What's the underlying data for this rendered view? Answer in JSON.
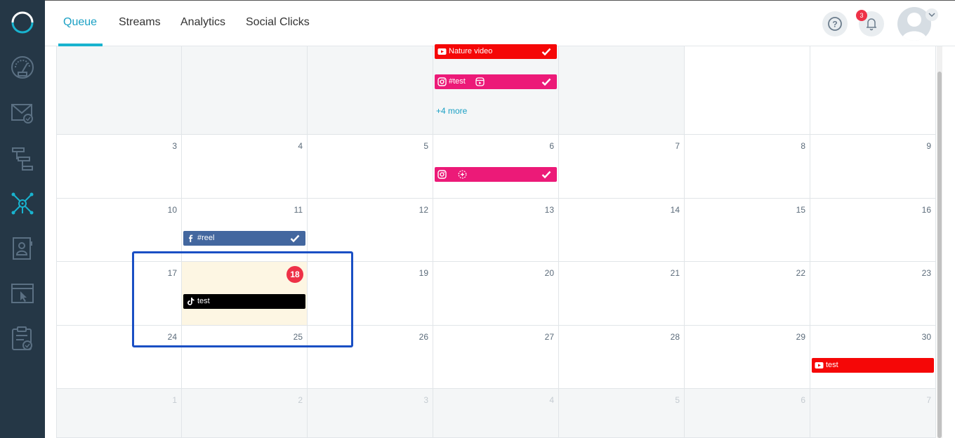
{
  "nav": {
    "tabs": [
      {
        "label": "Queue",
        "active": true
      },
      {
        "label": "Streams"
      },
      {
        "label": "Analytics"
      },
      {
        "label": "Social Clicks"
      }
    ],
    "notification_count": "3"
  },
  "sidebar_icons": [
    "logo",
    "speedometer-icon",
    "mail-icon",
    "workflow-icon",
    "social-network-icon",
    "contacts-icon",
    "landing-page-icon",
    "tasks-icon"
  ],
  "calendar": {
    "weeks": [
      {
        "days": [
          {
            "day": "",
            "state": "past",
            "posts": []
          },
          {
            "day": "",
            "state": "past",
            "posts": []
          },
          {
            "day": "",
            "state": "past",
            "posts": []
          },
          {
            "day": "",
            "state": "past",
            "posts": [
              {
                "network": "youtube",
                "label": "Nature video",
                "checked": true
              },
              {
                "network": "instagram",
                "label": "#test",
                "reel": true,
                "checked": true
              }
            ],
            "more": "+4 more"
          },
          {
            "day": "",
            "state": "past",
            "posts": []
          },
          {
            "day": "",
            "state": "normal",
            "posts": []
          },
          {
            "day": "",
            "state": "normal",
            "posts": []
          }
        ]
      },
      {
        "days": [
          {
            "day": "3",
            "state": "normal",
            "posts": []
          },
          {
            "day": "4",
            "state": "normal",
            "posts": []
          },
          {
            "day": "5",
            "state": "normal",
            "posts": []
          },
          {
            "day": "6",
            "state": "normal",
            "posts": [
              {
                "network": "instagram",
                "label": "",
                "story": true,
                "checked": true
              }
            ]
          },
          {
            "day": "7",
            "state": "normal",
            "posts": []
          },
          {
            "day": "8",
            "state": "normal",
            "posts": []
          },
          {
            "day": "9",
            "state": "normal",
            "posts": []
          }
        ]
      },
      {
        "days": [
          {
            "day": "10",
            "state": "normal",
            "posts": []
          },
          {
            "day": "11",
            "state": "normal",
            "posts": [
              {
                "network": "facebook",
                "label": "#reel",
                "checked": true
              }
            ]
          },
          {
            "day": "12",
            "state": "normal",
            "posts": []
          },
          {
            "day": "13",
            "state": "normal",
            "posts": []
          },
          {
            "day": "14",
            "state": "normal",
            "posts": []
          },
          {
            "day": "15",
            "state": "normal",
            "posts": []
          },
          {
            "day": "16",
            "state": "normal",
            "posts": []
          }
        ]
      },
      {
        "days": [
          {
            "day": "17",
            "state": "normal",
            "posts": []
          },
          {
            "day": "18",
            "state": "today",
            "posts": [
              {
                "network": "tiktok",
                "label": "test",
                "checked": false
              }
            ]
          },
          {
            "day": "19",
            "state": "normal",
            "posts": []
          },
          {
            "day": "20",
            "state": "normal",
            "posts": []
          },
          {
            "day": "21",
            "state": "normal",
            "posts": []
          },
          {
            "day": "22",
            "state": "normal",
            "posts": []
          },
          {
            "day": "23",
            "state": "normal",
            "posts": []
          }
        ]
      },
      {
        "days": [
          {
            "day": "24",
            "state": "normal",
            "posts": []
          },
          {
            "day": "25",
            "state": "normal",
            "posts": []
          },
          {
            "day": "26",
            "state": "normal",
            "posts": []
          },
          {
            "day": "27",
            "state": "normal",
            "posts": []
          },
          {
            "day": "28",
            "state": "normal",
            "posts": []
          },
          {
            "day": "29",
            "state": "normal",
            "posts": []
          },
          {
            "day": "30",
            "state": "normal",
            "posts": [
              {
                "network": "youtube",
                "label": "test",
                "checked": false
              }
            ]
          }
        ]
      },
      {
        "days": [
          {
            "day": "1",
            "state": "outside",
            "posts": []
          },
          {
            "day": "2",
            "state": "outside",
            "posts": []
          },
          {
            "day": "3",
            "state": "outside",
            "posts": []
          },
          {
            "day": "4",
            "state": "outside",
            "posts": []
          },
          {
            "day": "5",
            "state": "outside",
            "posts": []
          },
          {
            "day": "6",
            "state": "outside",
            "posts": []
          },
          {
            "day": "7",
            "state": "outside",
            "posts": []
          }
        ]
      }
    ]
  },
  "colors": {
    "youtube": "#f50707",
    "instagram": "#ec1a78",
    "facebook": "#43679f",
    "tiktok": "#000000",
    "accent": "#1aa0c4",
    "highlight": "#1a4fc4"
  }
}
